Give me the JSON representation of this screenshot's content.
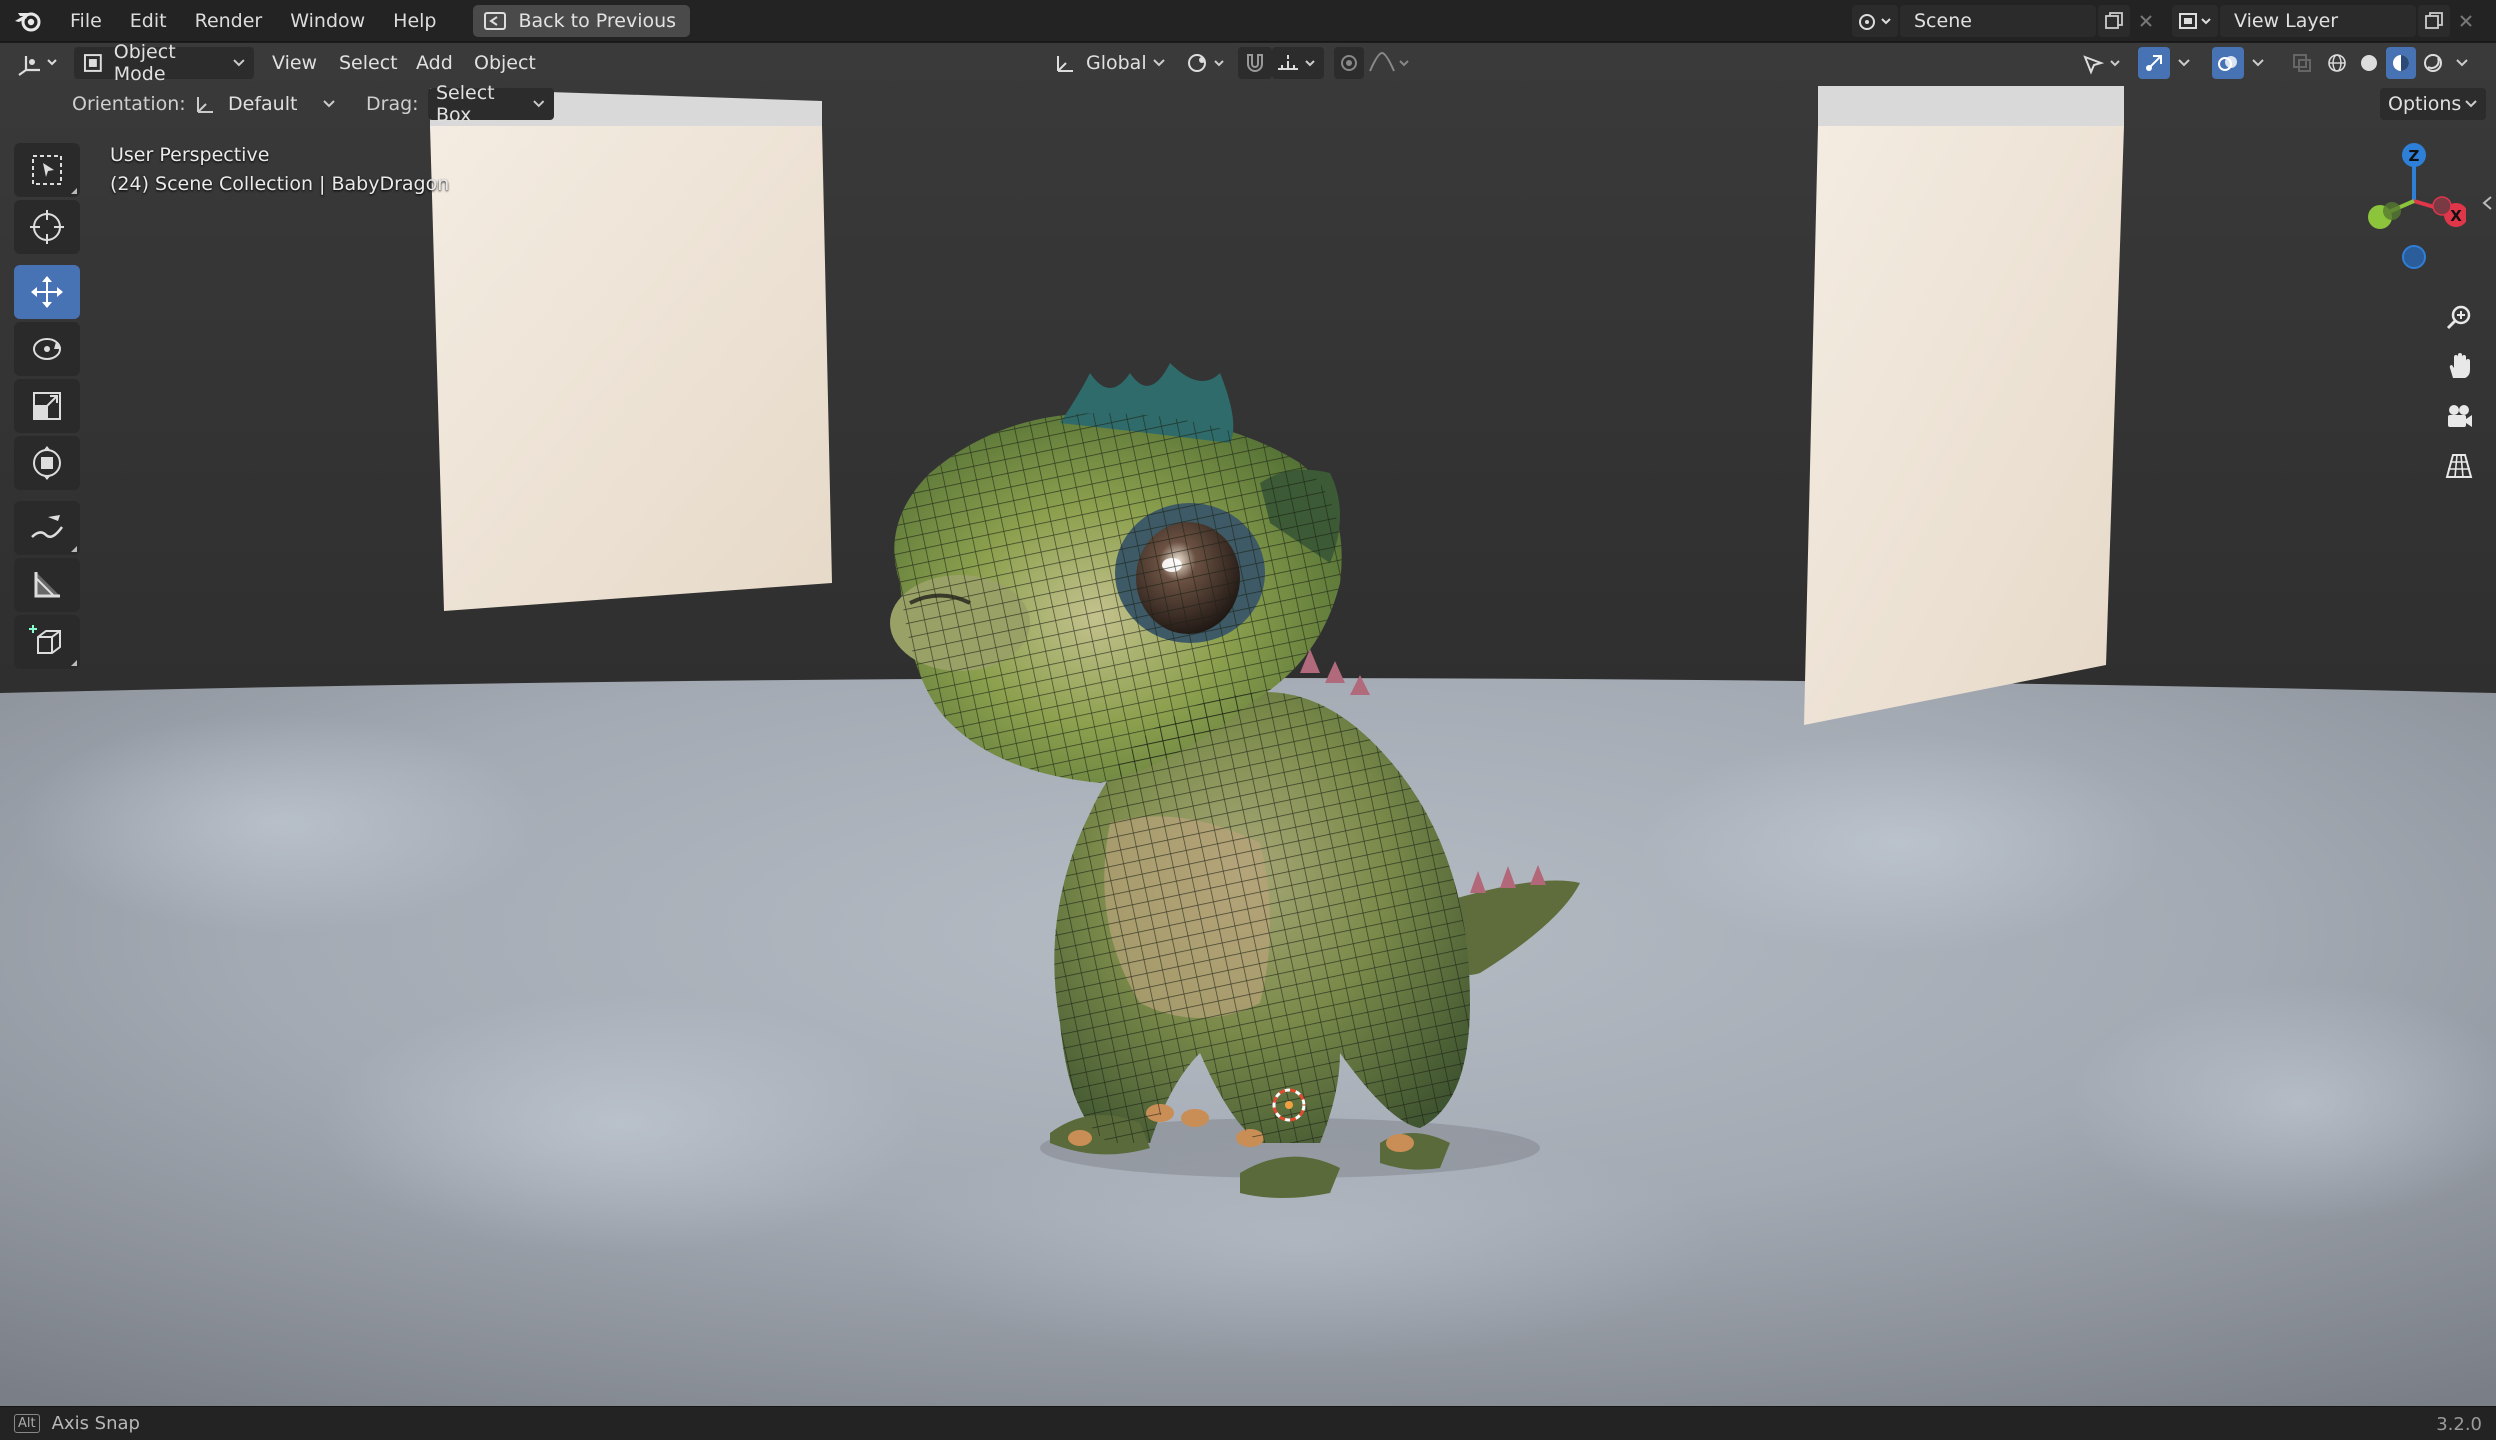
{
  "topbar": {
    "menus": [
      "File",
      "Edit",
      "Render",
      "Window",
      "Help"
    ],
    "back_button": "Back to Previous",
    "scene_name": "Scene",
    "view_layer": "View Layer"
  },
  "viewport_header": {
    "mode": "Object Mode",
    "menus": [
      "View",
      "Select",
      "Add",
      "Object"
    ],
    "transform_orientation": "Global",
    "options_label": "Options"
  },
  "tool_header": {
    "orientation_label": "Orientation:",
    "orientation_value": "Default",
    "drag_label": "Drag:",
    "drag_value": "Select Box"
  },
  "overlay": {
    "view_name": "User Perspective",
    "collection_info": "(24) Scene Collection | BabyDragon"
  },
  "gizmo": {
    "axes": [
      "Z",
      "X"
    ],
    "colors": {
      "x": "#e0364a",
      "y": "#8cc43c",
      "z": "#2e7fd8"
    }
  },
  "toolbar": {
    "tools": [
      "select-box",
      "cursor",
      "move",
      "rotate",
      "scale",
      "transform",
      "annotate",
      "measure",
      "add-cube"
    ],
    "active": "move"
  },
  "statusbar": {
    "key": "Alt",
    "hint": "Axis Snap",
    "version": "3.2.0"
  },
  "colors": {
    "accent": "#4772b3",
    "topbar_bg": "#232323",
    "floor": "#a8aeb6"
  }
}
